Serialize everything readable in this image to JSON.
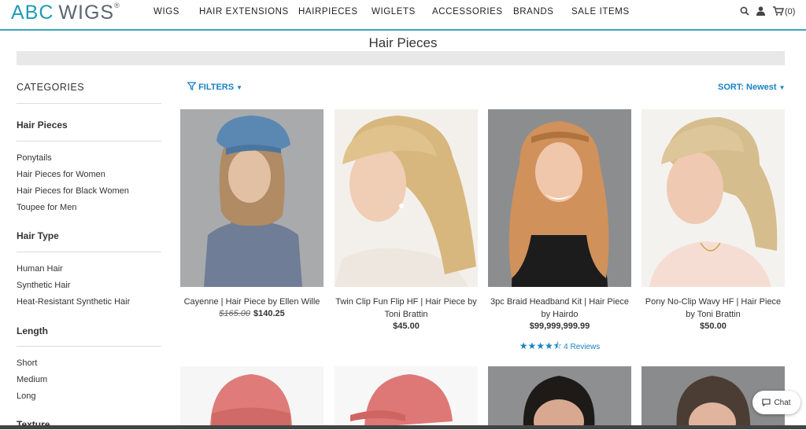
{
  "header": {
    "logo": {
      "abc": "ABC",
      "wigs": "WIGS",
      "reg": "®"
    },
    "nav": [
      "WIGS",
      "HAIR EXTENSIONS",
      "HAIRPIECES",
      "WIGLETS",
      "ACCESSORIES",
      "BRANDS",
      "SALE ITEMS"
    ],
    "cart_count": "(0)"
  },
  "page_title": "Hair Pieces",
  "sidebar": {
    "heading": "CATEGORIES",
    "sections": [
      {
        "title": "Hair Pieces",
        "links": [
          "Ponytails",
          "Hair Pieces for Women",
          "Hair Pieces for Black Women",
          "Toupee for Men"
        ]
      },
      {
        "title": "Hair Type",
        "links": [
          "Human Hair",
          "Synthetic Hair",
          "Heat-Resistant Synthetic Hair"
        ]
      },
      {
        "title": "Length",
        "links": [
          "Short",
          "Medium",
          "Long"
        ]
      },
      {
        "title": "Texture",
        "links": []
      }
    ]
  },
  "toolbar": {
    "filters": "FILTERS",
    "sort": "SORT: Newest"
  },
  "products": [
    {
      "name": "Cayenne | Hair Piece by Ellen Wille",
      "old_price": "$165.00",
      "price": "$140.25"
    },
    {
      "name": "Twin Clip Fun Flip HF | Hair Piece by Toni Brattin",
      "price": "$45.00"
    },
    {
      "name": "3pc Braid Headband Kit | Hair Piece by Hairdo",
      "price": "$99,999,999.99",
      "rating": 4.5,
      "reviews": "4 Reviews"
    },
    {
      "name": "Pony No-Clip Wavy HF | Hair Piece by Toni Brattin",
      "price": "$50.00"
    }
  ],
  "chat_label": "Chat",
  "icons": [
    "search-icon",
    "user-icon",
    "cart-icon",
    "filter-icon",
    "chevron-down-icon",
    "chat-icon",
    "star-icon"
  ]
}
